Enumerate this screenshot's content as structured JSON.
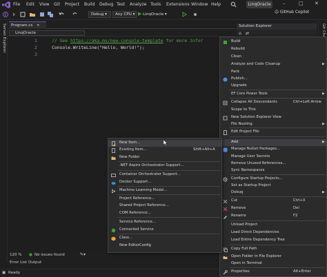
{
  "menu_bar": {
    "items": [
      "File",
      "Edit",
      "View",
      "Git",
      "Project",
      "Build",
      "Debug",
      "Test",
      "Analyze",
      "Tools",
      "Extensions",
      "Window",
      "Help"
    ],
    "search_icon": "search-icon",
    "solution_name": "LinqOracle"
  },
  "toolbar": {
    "configuration": "Debug",
    "platform": "Any CPU",
    "start_target": "LinqOracle",
    "copilot_label": "GitHub Copilot"
  },
  "left_rail": {
    "server_explorer_label": "Server Explorer"
  },
  "right_rail": {
    "git_changes_label": "Git Changes"
  },
  "editor": {
    "tab_label": "Program.cs",
    "nav_label": "LinqOracle",
    "lines": [
      {
        "number": "1",
        "comment_prefix": "// See ",
        "link": "https://aka.ms/new-console-template",
        "comment_suffix": " for more infor"
      },
      {
        "number": "2",
        "code": "Console.WriteLine(\"Hello, World!\");"
      },
      {
        "number": "3",
        "code": ""
      }
    ],
    "zoom": "120 %",
    "issues": "No issues found"
  },
  "bottom_tabs": [
    "Error List",
    "Output"
  ],
  "status_bar": {
    "text": "Ready"
  },
  "solution_explorer": {
    "title": "Solution Explorer"
  },
  "context_menu": {
    "items": [
      {
        "label": "Build",
        "icon": "build-icon"
      },
      {
        "label": "Rebuild"
      },
      {
        "label": "Clean"
      },
      {
        "label": "Analyze and Code Cleanup",
        "submenu": true
      },
      {
        "label": "Pack"
      },
      {
        "label": "Publish...",
        "icon": "publish-icon"
      },
      {
        "label": "Upgrade"
      },
      {
        "label": "EF Core Power Tools",
        "submenu": true
      },
      {
        "label": "Collapse All Descendants",
        "shortcut": "Ctrl+Left Arrow",
        "icon": "collapse-icon"
      },
      {
        "label": "Scope to This"
      },
      {
        "label": "New Solution Explorer View",
        "icon": "new-view-icon"
      },
      {
        "label": "File Nesting",
        "submenu": true
      },
      {
        "label": "Edit Project File",
        "icon": "edit-file-icon"
      },
      {
        "label": "Add",
        "submenu": true,
        "highlighted": true
      },
      {
        "label": "Manage NuGet Packages...",
        "icon": "nuget-icon"
      },
      {
        "label": "Manage User Secrets"
      },
      {
        "label": "Remove Unused References..."
      },
      {
        "label": "Sync Namespaces"
      },
      {
        "label": "Configure Startup Projects...",
        "icon": "gear-icon"
      },
      {
        "label": "Set as Startup Project"
      },
      {
        "label": "Debug",
        "submenu": true
      },
      {
        "label": "Cut",
        "shortcut": "Ctrl+X",
        "icon": "cut-icon"
      },
      {
        "label": "Remove",
        "shortcut": "Del",
        "icon": "remove-icon"
      },
      {
        "label": "Rename",
        "shortcut": "F2",
        "icon": "rename-icon"
      },
      {
        "label": "Unload Project"
      },
      {
        "label": "Load Direct Dependencies"
      },
      {
        "label": "Load Entire Dependency Tree"
      },
      {
        "label": "Copy Full Path",
        "icon": "copy-icon"
      },
      {
        "label": "Open Folder in File Explorer",
        "icon": "folder-open-icon"
      },
      {
        "label": "Open in Terminal"
      },
      {
        "label": "Properties",
        "shortcut": "Alt+Enter",
        "icon": "wrench-icon"
      }
    ]
  },
  "add_submenu": {
    "items": [
      {
        "label": "New Item...",
        "icon": "new-item-icon",
        "highlighted": true
      },
      {
        "label": "Existing Item...",
        "shortcut": "Shift+Alt+A",
        "icon": "existing-item-icon"
      },
      {
        "label": "New Folder",
        "icon": "folder-icon"
      },
      {
        "label": ".NET Aspire Orchestrator Support..."
      },
      {
        "label": "Container Orchestrator Support...",
        "icon": "container-icon"
      },
      {
        "label": "Docker Support...",
        "icon": "docker-icon"
      },
      {
        "label": "Machine Learning Model...",
        "icon": "ml-icon"
      },
      {
        "label": "Project Reference..."
      },
      {
        "label": "Shared Project Reference..."
      },
      {
        "label": "COM Reference..."
      },
      {
        "label": "Service Reference..."
      },
      {
        "label": "Connected Service",
        "icon": "connected-service-icon"
      },
      {
        "label": "Class...",
        "icon": "class-icon"
      },
      {
        "label": "New EditorConfig"
      }
    ]
  },
  "colors": {
    "background": "#1f1f1f",
    "menu_bg": "#2b2b2b",
    "highlight": "#3e3e42",
    "vs_purple": "#8661c5",
    "comment_green": "#57a64a",
    "build_green": "#3fa33a"
  }
}
